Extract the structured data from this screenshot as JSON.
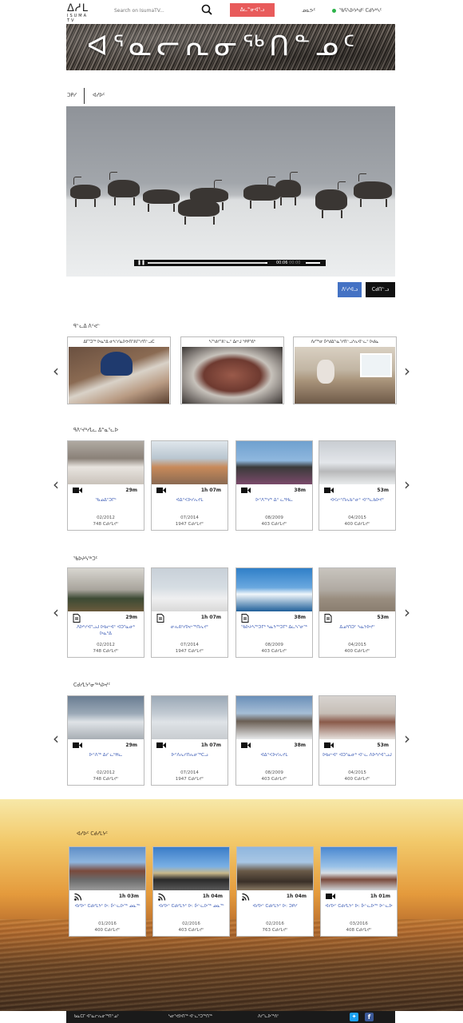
{
  "header": {
    "logo_syllabics": "ᐃᓱᒪ",
    "logo_word": "ISUMA TV",
    "search_placeholder": "Search on IsumaTV...",
    "signup_label": "ᐃᓚᓐᓂᐊᕐᓗ",
    "language_label": "ᓄᓇᕗᑦ",
    "user_label": "ᖃᕋᓴᐅᔭᒃᑯᑦ ᑕᑯᔭᒃᓴᑦ"
  },
  "banner": {
    "title": "ᐊᕐᓇᓕᕆᓂᖅᑎᓐᓄᑦ"
  },
  "breadcrumb": {
    "home": "ᑐᑭᓯ",
    "current": "ᐊᓯᐅᑦ"
  },
  "video": {
    "time_current": "00:06",
    "time_total": "00:00",
    "progress": 0.98
  },
  "actions": {
    "share_label": "ᐱᑦᓯᐊᓗ",
    "download_label": "ᑕᑯᑎᓪᓗ"
  },
  "featured": {
    "title": "ᑫᓪᓚᐃ ᐱᕝᕙᓪ",
    "items": [
      {
        "title": "ᐃᒥᕐᑐᖅ ᐅᓇᒃᐃ ᓂᓴᑦᓯᓇᐅᕗᑎᕐᕕᒋᑦᓯᑎᓪᓗᑕ"
      },
      {
        "title": "ᓴᕐᖁᓯᕐᕕᓪᓚᑦ ᐃᓕᒍ ᕿᑭᕐᕕᒃ"
      },
      {
        "title": "ᐱᓯᖅᓂ ᐆᒃᑯᐃᓐᓇᕐᓱᑎᓪᓗᒃᕆᐊᓪᓚᑦ ᐅᑯᓇ"
      }
    ]
  },
  "sections": [
    {
      "title": "ᑫᐱᕝᔪᒃᓯᒪᓚ ᐃᓐᓇᕐᓚᐅ",
      "items": [
        {
          "duration": "29m",
          "title": "ᖃᓄᐃᑦᑐᒥᒃ",
          "date": "02/2012",
          "views": "748 ᑕᑯᓯᒪᔪᑦ"
        },
        {
          "duration": "1h 07m",
          "title": "ᐊᐃᑉᐸᐅᓯᕆᔪᒪ",
          "date": "07/2014",
          "views": "1947 ᑕᑯᓯᒪᔪᑦ"
        },
        {
          "duration": "38m",
          "title": "ᐅᑉᐱᖅᓯᒃ ᐃᑉ ᓚᒃᕼᓚ",
          "date": "08/2009",
          "views": "403 ᑕᑯᓯᒪᔪᑦ"
        },
        {
          "duration": "53m",
          "title": "ᐊᐸᓕᑦᑎᕆᑲᓐᓂᑦ ᐊᑉᒃᓚᑲᐅᔪᑦ",
          "date": "04/2015",
          "views": "400 ᑕᑯᓯᒪᔪᑦ"
        }
      ]
    },
    {
      "title": "ᖃᐅᔨᓴᖅᑐᑦ",
      "items": [
        {
          "duration": "29m",
          "title": "ᐱᐅᒃᓯᐊᕐᓗᒍ ᐅᑲᓕᐊᑦ ᐊᑐᕐᓇᓂᒃ ᐅᓇᒃᐃ",
          "date": "02/2012",
          "views": "748 ᑕᑯᓯᒪᔪᑦ"
        },
        {
          "duration": "1h 07m",
          "title": "ᓂᕆᕕᒃᓯᐅᓕᕐᒃᑎᕆᔪᑦ",
          "date": "07/2014",
          "views": "1947 ᑕᑯᓯᒪᔪᑦ"
        },
        {
          "duration": "38m",
          "title": "ᖃᐅᔨᓴᖅᑐᒥᒃ ᓴᓇᔭᖅᑐᒥᒃ ᐃᓚᓴᕐᓂᖅ",
          "date": "08/2009",
          "views": "403 ᑕᑯᓯᒪᔪᑦ"
        },
        {
          "duration": "53m",
          "title": "ᐃᓄᒃᑎᑐᑦ ᓴᓇᔭᐅᔪᑦ",
          "date": "04/2015",
          "views": "400 ᑕᑯᓯᒪᔪᑦ"
        }
      ]
    },
    {
      "title": "ᑕᑯᓯᒪᔭᕐᓂᖅᓴᐅᔪᑦ",
      "items": [
        {
          "duration": "29m",
          "title": "ᐅᑉᐱᖅ ᐃᓯ ᓚᒃᕼᓚ",
          "date": "02/2012",
          "views": "748 ᑕᑯᓯᒪᔪᑦ"
        },
        {
          "duration": "1h 07m",
          "title": "ᐅᑉᐱᕆᓯᑎᕆᓂᖅᑕᓗ",
          "date": "07/2014",
          "views": "1947 ᑕᑯᓯᒪᔪᑦ"
        },
        {
          "duration": "38m",
          "title": "ᐊᐃᑉᐸᐅᓯᕆᔪᒪ",
          "date": "08/2009",
          "views": "403 ᑕᑯᓯᒪᔪᑦ"
        },
        {
          "duration": "53m",
          "title": "ᐅᑲᓕᐊᑦ ᐊᑐᕐᓇᓂᒃ ᐊᓪᓚ ᐱᐅᒃᓯᐊᕐᓗᒍ",
          "date": "04/2015",
          "views": "400 ᑕᑯᓯᒪᔪᑦ"
        }
      ]
    }
  ],
  "latest": {
    "title": "ᐊᓯᐅᑦ ᑕᑯᓯᒪᔭᑦ",
    "items": [
      {
        "duration": "1h 03m",
        "title": "ᐊᓯᐅᑦ ᑕᑯᓯᒪᔭᑦ ᐅ: ᐆᓪᓚᐅᖅ ᓄᓇᖅ",
        "date": "01/2016",
        "views": "400 ᑕᑯᓯᒪᔪᑦ"
      },
      {
        "duration": "1h 04m",
        "title": "ᐊᓯᐅᑦ ᑕᑯᓯᒪᔭᑦ ᐅ: ᐆᓪᓚᐅᖅ ᓄᓇᖅ",
        "date": "02/2016",
        "views": "403 ᑕᑯᓯᒪᔪᑦ"
      },
      {
        "duration": "1h 04m",
        "title": "ᐊᓯᐅᑦ ᑕᑯᓯᒪᔭᑦ ᐅ: ᑐᑭᓯ",
        "date": "02/2016",
        "views": "763 ᑕᑯᓯᒪᔪᑦ"
      },
      {
        "duration": "1h 01m",
        "title": "ᐊᓯᐅᑦ ᑕᑯᓯᒪᔭᑦ ᐅ: ᐆᓪᓚᐅᖅ ᐅᓪᓚᐅ",
        "date": "03/2016",
        "views": "408 ᑕᑯᓯᒪᔪᑦ"
      }
    ]
  },
  "footer": {
    "links": [
      "ᑲᓇᑕᒥ ᐊᕐᓇᓕᕆᓂᖅᑎᓐᓄᑦ",
      "ᓴᓂᕐᕙᐅᑎᖅ ᐊᓪᓚᒃᑐᖅᑎᖅ",
      "ᐱᓯᕐᓚᐅᖅᐱᑦ"
    ]
  }
}
